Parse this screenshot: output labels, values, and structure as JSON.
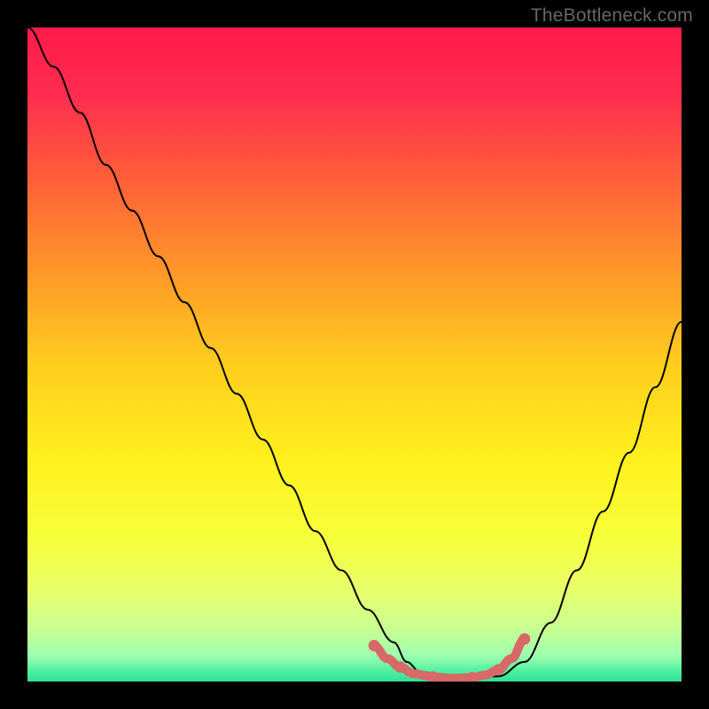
{
  "watermark": "TheBottleneck.com",
  "chart_data": {
    "type": "line",
    "title": "",
    "xlabel": "",
    "ylabel": "",
    "xlim": [
      0,
      100
    ],
    "ylim": [
      0,
      100
    ],
    "background": {
      "kind": "vertical-gradient",
      "stops": [
        {
          "pos": 0.0,
          "color": "#ff1a4a"
        },
        {
          "pos": 0.1,
          "color": "#ff2c4f"
        },
        {
          "pos": 0.22,
          "color": "#ff5a3a"
        },
        {
          "pos": 0.38,
          "color": "#ff9a28"
        },
        {
          "pos": 0.52,
          "color": "#ffcf1e"
        },
        {
          "pos": 0.66,
          "color": "#fff01e"
        },
        {
          "pos": 0.78,
          "color": "#f7ff3a"
        },
        {
          "pos": 0.86,
          "color": "#e8ff6a"
        },
        {
          "pos": 0.92,
          "color": "#c8ff92"
        },
        {
          "pos": 0.96,
          "color": "#a0ffb0"
        },
        {
          "pos": 0.985,
          "color": "#4cf0a0"
        },
        {
          "pos": 1.0,
          "color": "#2fe095"
        }
      ]
    },
    "series": [
      {
        "name": "bottleneck-curve",
        "color": "#000000",
        "stroke_width": 2,
        "x": [
          0,
          4,
          8,
          12,
          16,
          20,
          24,
          28,
          32,
          36,
          40,
          44,
          48,
          52,
          56,
          58,
          60,
          64,
          68,
          72,
          76,
          80,
          84,
          88,
          92,
          96,
          100
        ],
        "y": [
          100,
          94,
          87,
          79,
          72,
          65,
          58,
          51,
          44,
          37,
          30,
          23,
          17,
          11,
          6,
          3,
          1.5,
          0.8,
          0.5,
          0.8,
          3,
          9,
          17,
          26,
          35,
          45,
          55
        ]
      },
      {
        "name": "optimal-band-marker",
        "color": "#d96868",
        "stroke_width": 10,
        "x": [
          53,
          55,
          57,
          59,
          62,
          65,
          68,
          70,
          72,
          74,
          76
        ],
        "y": [
          5.5,
          3.5,
          2.2,
          1.2,
          0.7,
          0.5,
          0.6,
          1.0,
          1.8,
          3.5,
          6.5
        ]
      }
    ]
  }
}
